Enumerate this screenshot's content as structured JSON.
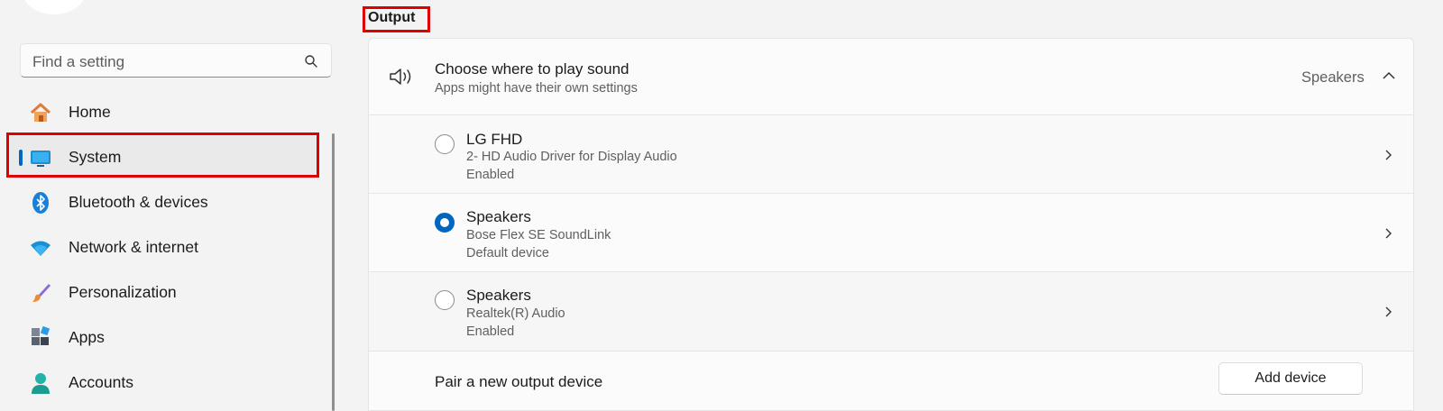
{
  "search": {
    "placeholder": "Find a setting"
  },
  "sidebar": {
    "items": [
      {
        "label": "Home",
        "icon": "home-icon"
      },
      {
        "label": "System",
        "icon": "system-icon",
        "selected": true
      },
      {
        "label": "Bluetooth & devices",
        "icon": "bluetooth-icon"
      },
      {
        "label": "Network & internet",
        "icon": "wifi-icon"
      },
      {
        "label": "Personalization",
        "icon": "brush-icon"
      },
      {
        "label": "Apps",
        "icon": "apps-icon"
      },
      {
        "label": "Accounts",
        "icon": "person-icon"
      }
    ]
  },
  "output": {
    "title": "Output",
    "choose": {
      "title": "Choose where to play sound",
      "subtitle": "Apps might have their own settings",
      "selected": "Speakers"
    },
    "devices": [
      {
        "name": "LG FHD",
        "line1": "2- HD Audio Driver for Display Audio",
        "line2": "Enabled",
        "selected": false
      },
      {
        "name": "Speakers",
        "line1": "Bose Flex SE SoundLink",
        "line2": "Default device",
        "selected": true
      },
      {
        "name": "Speakers",
        "line1": "Realtek(R) Audio",
        "line2": "Enabled",
        "selected": false
      }
    ],
    "pair": {
      "label": "Pair a new output device",
      "button": "Add device"
    }
  },
  "colors": {
    "accent": "#0067c0",
    "highlight": "#e00000"
  }
}
